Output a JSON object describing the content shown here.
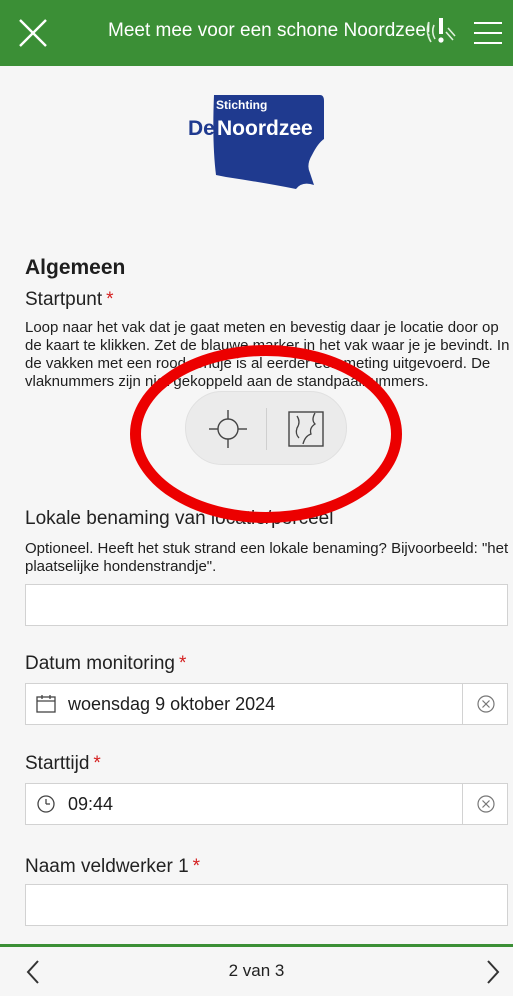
{
  "header": {
    "title": "Meet mee voor een schone Noordzee!",
    "close_icon": "close-icon",
    "gps_icon": "gps-status-icon",
    "menu_icon": "menu-icon",
    "background": "#3b8f36"
  },
  "logo": {
    "line1": "Stichting",
    "line2a": "De",
    "line2b": "Noordzee",
    "color": "#1f3a8f"
  },
  "form": {
    "section_title": "Algemeen",
    "startpunt": {
      "label": "Startpunt",
      "required": "*",
      "hint": "Loop naar het vak dat je gaat meten en bevestig daar je locatie door op de kaart te klikken. Zet de blauwe marker in het vak waar je je bevindt. In de vakken met een rood rondje is al eerder een meting uitgevoerd. De vlaknummers zijn niet gekoppeld aan de standpaalnummers.",
      "buttons": [
        "locate-icon",
        "map-icon"
      ]
    },
    "lokale_benaming": {
      "label": "Lokale benaming van locatie/perceel",
      "hint": "Optioneel. Heeft het stuk strand een lokale benaming? Bijvoorbeeld: \"het plaatselijke hondenstrandje\".",
      "value": ""
    },
    "datum": {
      "label": "Datum monitoring",
      "required": "*",
      "value": "woensdag 9 oktober 2024"
    },
    "starttijd": {
      "label": "Starttijd",
      "required": "*",
      "value": "09:44"
    },
    "veldwerker": {
      "label": "Naam veldwerker 1",
      "required": "*",
      "value": ""
    }
  },
  "footer": {
    "page": "2 van 3",
    "prev_icon": "chevron-left-icon",
    "next_icon": "chevron-right-icon"
  },
  "annotation_color": "#ec0000"
}
